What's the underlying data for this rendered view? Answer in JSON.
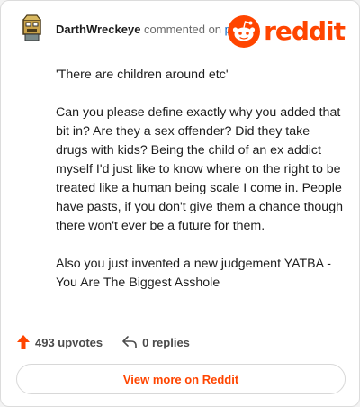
{
  "header": {
    "username": "DarthWreckeye",
    "commented_text": "commented on",
    "post_link": "post",
    "logo_text": "reddit"
  },
  "comment": {
    "paragraphs": [
      "'There are children around etc'",
      "Can you please define exactly why you added that bit in? Are they a sex offender? Did they take drugs with kids? Being the child of an ex addict myself I'd just like to know where on the right to be treated like a human being scale I come in. People have pasts, if you don't give them a chance though there won't ever be a future for them.",
      "Also you just invented a new judgement YATBA - You Are The Biggest Asshole"
    ]
  },
  "actions": {
    "upvotes": "493 upvotes",
    "replies": "0 replies",
    "upvote_icon": "upvote-arrow-icon",
    "reply_icon": "reply-arrow-icon"
  },
  "footer": {
    "view_more": "View more on Reddit"
  },
  "colors": {
    "brand": "#ff4500",
    "link": "#0a66c2"
  }
}
